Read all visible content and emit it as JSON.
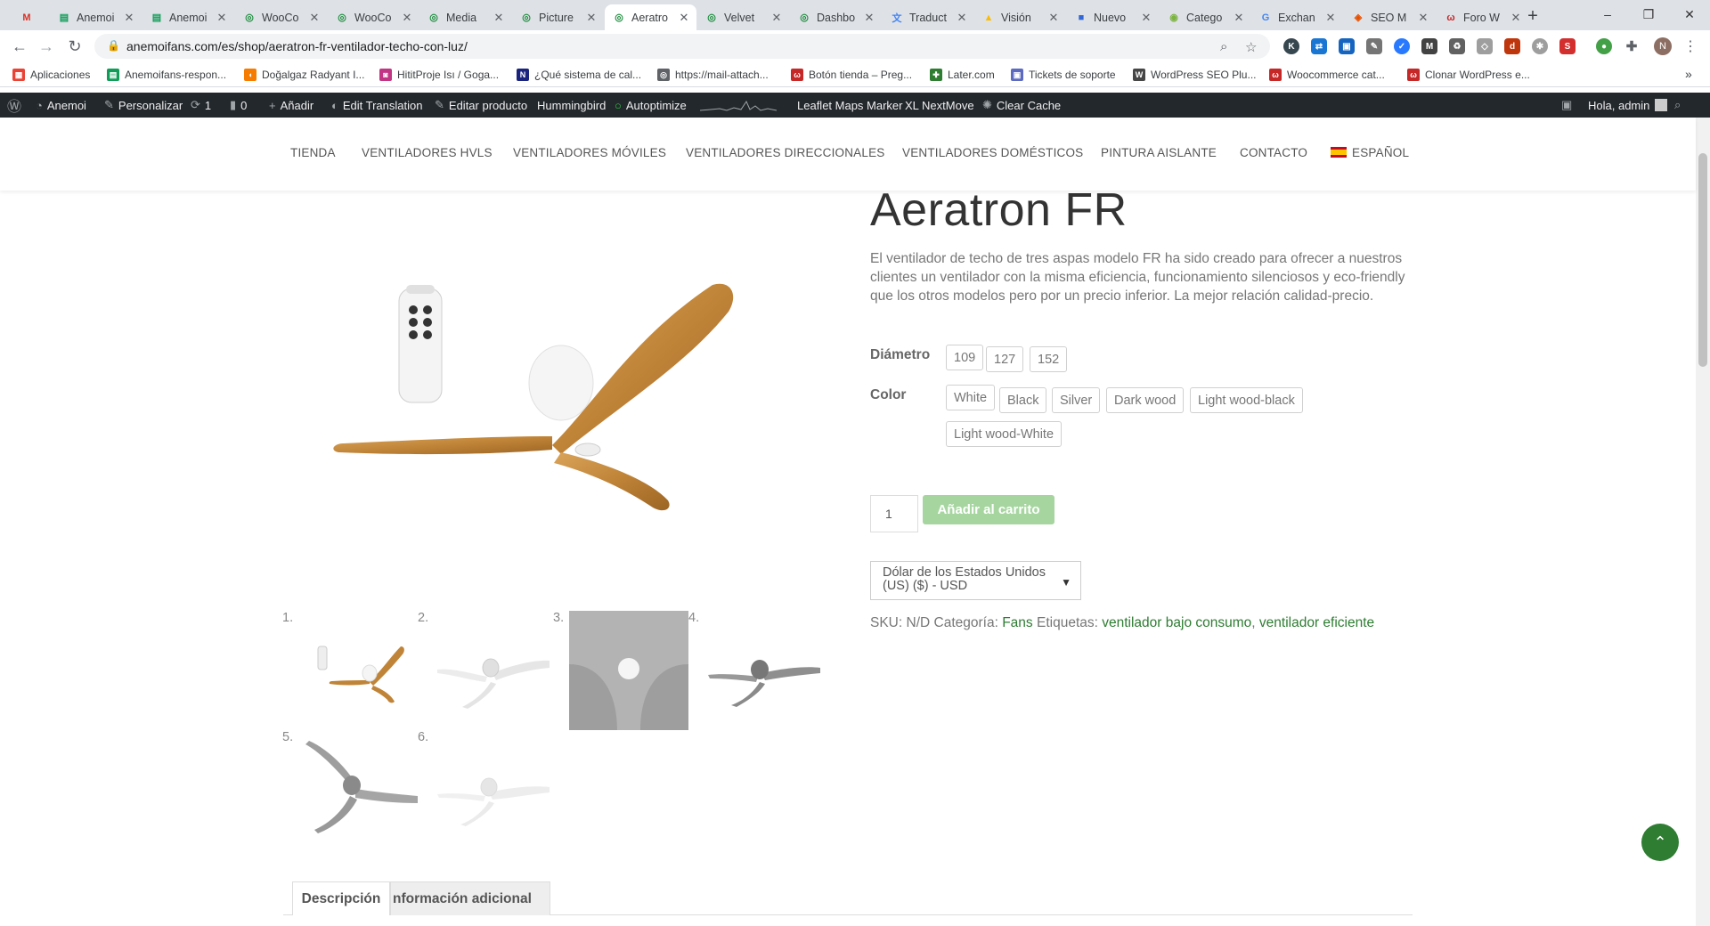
{
  "browser": {
    "tabs": [
      {
        "title": "",
        "icon": "gmail-icon",
        "color": "#d93025"
      },
      {
        "title": "Anemoi",
        "icon": "sheets-icon",
        "color": "#0f9d58"
      },
      {
        "title": "Anemoi",
        "icon": "sheets-icon",
        "color": "#0f9d58"
      },
      {
        "title": "WooCo",
        "icon": "globe-icon",
        "color": "#1e8e3e"
      },
      {
        "title": "WooCo",
        "icon": "globe-icon",
        "color": "#1e8e3e"
      },
      {
        "title": "Media",
        "icon": "globe-icon",
        "color": "#1e8e3e"
      },
      {
        "title": "Picture",
        "icon": "globe-icon",
        "color": "#1e8e3e"
      },
      {
        "title": "Aeratro",
        "icon": "globe-icon",
        "color": "#1e8e3e"
      },
      {
        "title": "Velvet",
        "icon": "globe-icon",
        "color": "#1e8e3e"
      },
      {
        "title": "Dashbo",
        "icon": "globe-icon",
        "color": "#1e8e3e"
      },
      {
        "title": "Traduct",
        "icon": "translate-icon",
        "color": "#4285f4"
      },
      {
        "title": "Visión",
        "icon": "ads-icon",
        "color": "#fbbc04"
      },
      {
        "title": "Nuevo",
        "icon": "app-icon",
        "color": "#3367d6"
      },
      {
        "title": "Catego",
        "icon": "planet-icon",
        "color": "#7cb342"
      },
      {
        "title": "Exchan",
        "icon": "google-icon",
        "color": "#4285f4"
      },
      {
        "title": "SEO M",
        "icon": "seo-icon",
        "color": "#e65100"
      },
      {
        "title": "Foro W",
        "icon": "woo-icon",
        "color": "#c62828"
      }
    ],
    "active_tab": 7,
    "new_tab": "+",
    "url": "anemoifans.com/es/shop/aeratron-fr-ventilador-techo-con-luz/",
    "profile_initial": "N",
    "window_controls": {
      "minimize": "–",
      "maximize": "❐",
      "close": "✕"
    }
  },
  "bookmarks": [
    {
      "label": "Aplicaciones",
      "icon": "apps-grid-icon",
      "color": "#ea4335"
    },
    {
      "label": "Anemoifans-respon...",
      "icon": "sheets-icon",
      "color": "#0f9d58"
    },
    {
      "label": "Doğalgaz Radyant I...",
      "icon": "flame-icon",
      "color": "#f57c00"
    },
    {
      "label": "HititProje Isı / Goga...",
      "icon": "instagram-icon",
      "color": "#c13584"
    },
    {
      "label": "¿Qué sistema de cal...",
      "icon": "news-icon",
      "color": "#1a237e"
    },
    {
      "label": "https://mail-attach...",
      "icon": "globe-icon",
      "color": "#5f6368"
    },
    {
      "label": "Botón tienda – Preg...",
      "icon": "woo-icon",
      "color": "#c62828"
    },
    {
      "label": "Later.com",
      "icon": "later-icon",
      "color": "#2e7d32"
    },
    {
      "label": "Tickets de soporte",
      "icon": "ticket-icon",
      "color": "#5c6bc0"
    },
    {
      "label": "WordPress SEO Plu...",
      "icon": "wordpress-icon",
      "color": "#464646"
    },
    {
      "label": "Woocommerce cat...",
      "icon": "woo-icon",
      "color": "#c62828"
    },
    {
      "label": "Clonar WordPress e...",
      "icon": "woo-icon",
      "color": "#c62828"
    }
  ],
  "bookmarks_more": "»",
  "wpbar": {
    "site": "Anemoi",
    "customize": "Personalizar",
    "updates": "1",
    "comments": "0",
    "add": "Añadir",
    "translate": "Edit Translation",
    "edit_product": "Editar producto",
    "hummingbird": "Hummingbird",
    "autoptimize": "Autoptimize",
    "leaflet": "Leaflet Maps Marker",
    "nextmove": "XL NextMove",
    "clear_cache": "Clear Cache",
    "greeting": "Hola, admin"
  },
  "nav": {
    "items": [
      "TIENDA",
      "VENTILADORES HVLS",
      "VENTILADORES MÓVILES",
      "VENTILADORES DIRECCIONALES",
      "VENTILADORES DOMÉSTICOS",
      "PINTURA AISLANTE",
      "CONTACTO"
    ],
    "language": "ESPAÑOL"
  },
  "product": {
    "title": "Aeratron FR",
    "description": "El ventilador de techo de tres aspas modelo FR  ha sido creado para ofrecer a nuestros clientes un ventilador con la misma eficiencia, funcionamiento silenciosos y eco-friendly que los otros modelos pero por un precio inferior. La mejor relación calidad-precio.",
    "diameter_label": "Diámetro",
    "diameters": [
      "109",
      "127",
      "152"
    ],
    "color_label": "Color",
    "colors": [
      "White",
      "Black",
      "Silver",
      "Dark wood",
      "Light wood-black",
      "Light wood-White"
    ],
    "quantity": "1",
    "add_to_cart": "Añadir al carrito",
    "currency": "Dólar de los Estados Unidos (US) ($) - USD",
    "sku_label": "SKU:",
    "sku": "N/D",
    "category_label": "Categoría:",
    "category": "Fans",
    "tags_label": "Etiquetas:",
    "tag1": "ventilador bajo consumo",
    "tag_sep": ",",
    "tag2": "ventilador eficiente",
    "thumb_numbers": [
      "1.",
      "2.",
      "3.",
      "4.",
      "5.",
      "6."
    ],
    "tabs": [
      "Descripción",
      "nformación adicional"
    ]
  },
  "colors": {
    "accent_green": "#2e7d32",
    "button_green": "#a6d5a0",
    "wpbar_bg": "#23282d"
  }
}
